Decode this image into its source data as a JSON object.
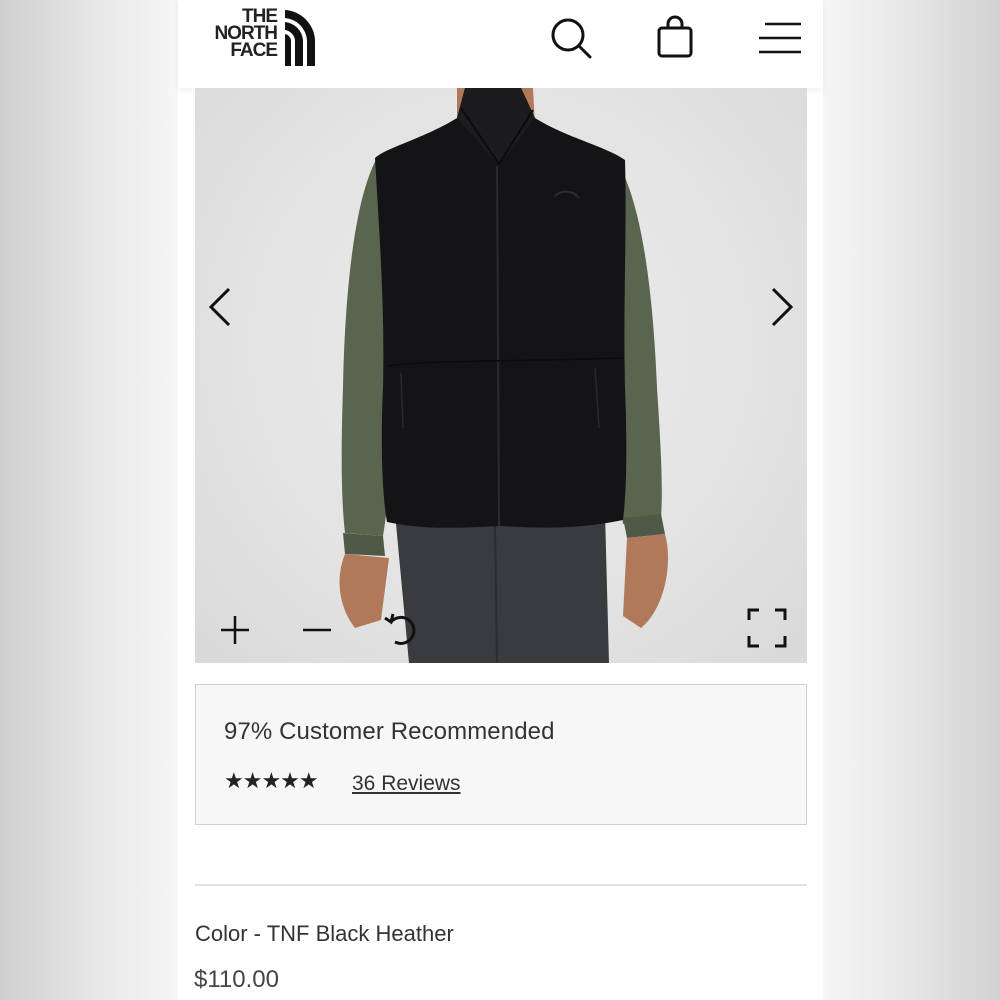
{
  "header": {
    "logo_lines": [
      "THE",
      "NORTH",
      "FACE"
    ],
    "icons": {
      "search": "search-icon",
      "bag": "shopping-bag-icon",
      "menu": "hamburger-menu-icon"
    }
  },
  "gallery": {
    "prev_icon": "chevron-left-icon",
    "next_icon": "chevron-right-icon",
    "zoom_in_icon": "plus-icon",
    "zoom_out_icon": "minus-icon",
    "reset_icon": "rotate-reset-icon",
    "fullscreen_icon": "fullscreen-icon"
  },
  "rating": {
    "recommend_text": "97% Customer Recommended",
    "stars": "★★★★★",
    "star_count": 5,
    "reviews_label": "36 Reviews"
  },
  "product": {
    "color_label": "Color - TNF Black Heather",
    "price": "$110.00"
  },
  "colors": {
    "accent": "#222222",
    "vest": "#141416",
    "shirt": "#59654f",
    "pants": "#3a3b3f"
  }
}
